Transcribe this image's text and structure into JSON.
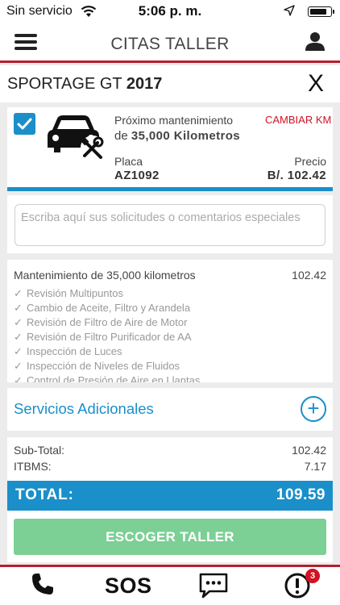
{
  "status_bar": {
    "carrier": "Sin servicio",
    "time": "5:06 p. m."
  },
  "nav": {
    "title": "CITAS TALLER"
  },
  "vehicle": {
    "model": "SPORTAGE GT",
    "year": "2017",
    "close_label": "X"
  },
  "maintenance_card": {
    "next_label": "Próximo mantenimiento",
    "next_prefix": "de",
    "next_value": "35,000 Kilometros",
    "change_km": "CAMBIAR KM",
    "plate_label": "Placa",
    "plate_value": "AZ1092",
    "price_label": "Precio",
    "price_value": "B/. 102.42",
    "checked": true
  },
  "comments": {
    "placeholder": "Escriba aquí sus solicitudes  o comentarios especiales"
  },
  "service_package": {
    "title": "Mantenimiento de 35,000 kilometros",
    "price": "102.42",
    "items": [
      "Revisión Multipuntos",
      "Cambio de Aceite, Filtro y Arandela",
      "Revisión de Filtro de Aire de Motor",
      "Revisión de Filtro Purificador de AA",
      "Inspección de Luces",
      "Inspección de Niveles de Fluidos",
      "Control de Presión de Aire en Llantas"
    ]
  },
  "additional_services": {
    "label": "Servicios Adicionales"
  },
  "totals": {
    "subtotal_label": "Sub-Total:",
    "subtotal_value": "102.42",
    "tax_label": "ITBMS:",
    "tax_value": "7.17",
    "total_label": "TOTAL:",
    "total_value": "109.59"
  },
  "primary_button": {
    "label": "ESCOGER TALLER"
  },
  "tab_bar": {
    "sos_label": "SOS",
    "alert_badge": "3"
  },
  "colors": {
    "accent_blue": "#1a8fc9",
    "brand_red": "#b3202f",
    "button_green": "#7ccf95",
    "alert_red": "#d01223"
  },
  "icons": [
    "wifi-icon",
    "location-arrow-icon",
    "battery-icon",
    "menu-icon",
    "user-icon",
    "close-icon",
    "checkbox-icon",
    "car-service-icon",
    "check-icon",
    "plus-circle-icon",
    "phone-icon",
    "chat-icon",
    "alert-icon"
  ]
}
